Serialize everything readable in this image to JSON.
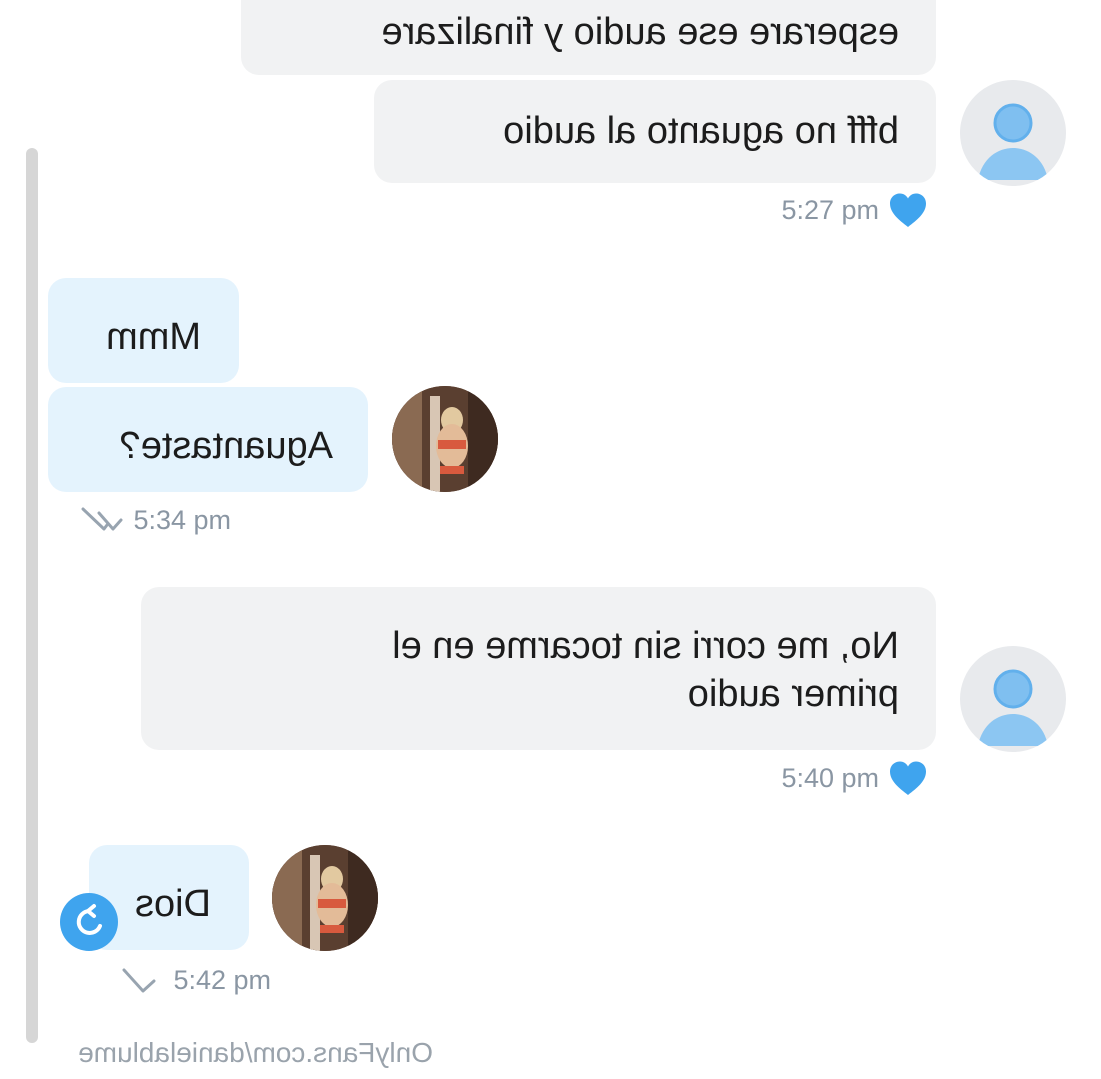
{
  "chat": {
    "messages": [
      {
        "id": "m1",
        "side": "self",
        "text": "Aguantaste?"
      },
      {
        "id": "m2",
        "side": "self",
        "text": "Mmm"
      },
      {
        "id": "m3",
        "side": "other",
        "text": "No, me corri sin tocarme en el\nprimer audio"
      },
      {
        "id": "m4",
        "side": "self",
        "text": "Dios"
      },
      {
        "id": "m5",
        "side": "other",
        "text": "esperare ese audio y finalizare"
      },
      {
        "id": "m6",
        "side": "other",
        "text": "bfff no aguanto al audio"
      }
    ],
    "timestamps": {
      "t1": "5:27 pm",
      "t2": "5:34 pm",
      "t3": "5:40 pm",
      "t4": "5:42 pm"
    }
  },
  "avatars": {
    "creator": "creator-photo-avatar",
    "fan": "default-user-avatar"
  },
  "icons": {
    "like": "heart-icon",
    "read": "double-check-icon",
    "sent": "single-check-icon",
    "action": "refresh-icon"
  },
  "watermark": "OnlyFans.com/danielablume",
  "colors": {
    "accent": "#3fa4ee",
    "bubble_self": "#e4f3fd",
    "bubble_other": "#f1f2f3",
    "timestamp": "#8a96a3"
  }
}
